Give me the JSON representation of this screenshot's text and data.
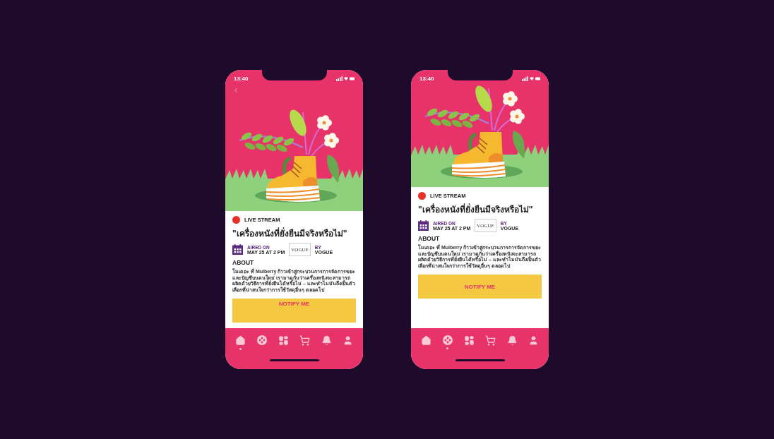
{
  "phones": [
    {
      "kind": "tall",
      "time": "13:40",
      "back_button": true,
      "live_label": "LIVE STREAM",
      "title": "\"เครื่องหนังที่ยั่งยืนมีจริงหรือไม่\"",
      "aired_label": "AIRED ON",
      "aired_date": "MAY 25 AT 2 PM",
      "logo": "VOGUE",
      "by_label": "BY",
      "by_value": "VOGUE",
      "about_heading": "ABOUT",
      "about_text": "โมเดอะ ที่ Mulberry ก้าวเข้าสู่กระบวนการการจัดการขยะและบัญชีบนตนใหม่ เรามาดูกันว่าเครื่องหนังจะสามารถผลิตด้วยวิธีการที่ยั่งยืนได้หรือไม่ – และทำไมมันถึงเป็นตัวเลือกที่น่าสนใจกว่าการใช้วัสดุอื่นๆ ตลอดไป",
      "button": "NOTIFY ME",
      "nav": [
        {
          "selected": true
        },
        {
          "selected": false
        },
        {
          "selected": false
        },
        {
          "selected": false
        },
        {
          "selected": false
        },
        {
          "selected": false
        }
      ]
    },
    {
      "kind": "short",
      "time": "13:40",
      "back_button": false,
      "live_label": "LIVE STREAM",
      "title": "\"เครื่องหนังที่ยั่งยืนมีจริงหรือไม่\"",
      "aired_label": "AIRED ON",
      "aired_date": "MAY 25 AT 2 PM",
      "logo": "VOGUE",
      "by_label": "BY",
      "by_value": "VOGUE",
      "about_heading": "ABOUT",
      "about_text": "โมเดอะ ที่ Mulberry ก้าวเข้าสู่กระบวนการการจัดการขยะและบัญชีบนตนใหม่ เรามาดูกันว่าเครื่องหนังจะสามารถผลิตด้วยวิธีการที่ยั่งยืนได้หรือไม่ – และทำไมมันถึงเป็นตัวเลือกที่น่าสนใจกว่าการใช้วัสดุอื่นๆ ตลอดไป",
      "button": "NOTIFY ME",
      "nav": [
        {
          "selected": false
        },
        {
          "selected": true
        },
        {
          "selected": false
        },
        {
          "selected": false
        },
        {
          "selected": false
        },
        {
          "selected": false
        }
      ]
    }
  ]
}
